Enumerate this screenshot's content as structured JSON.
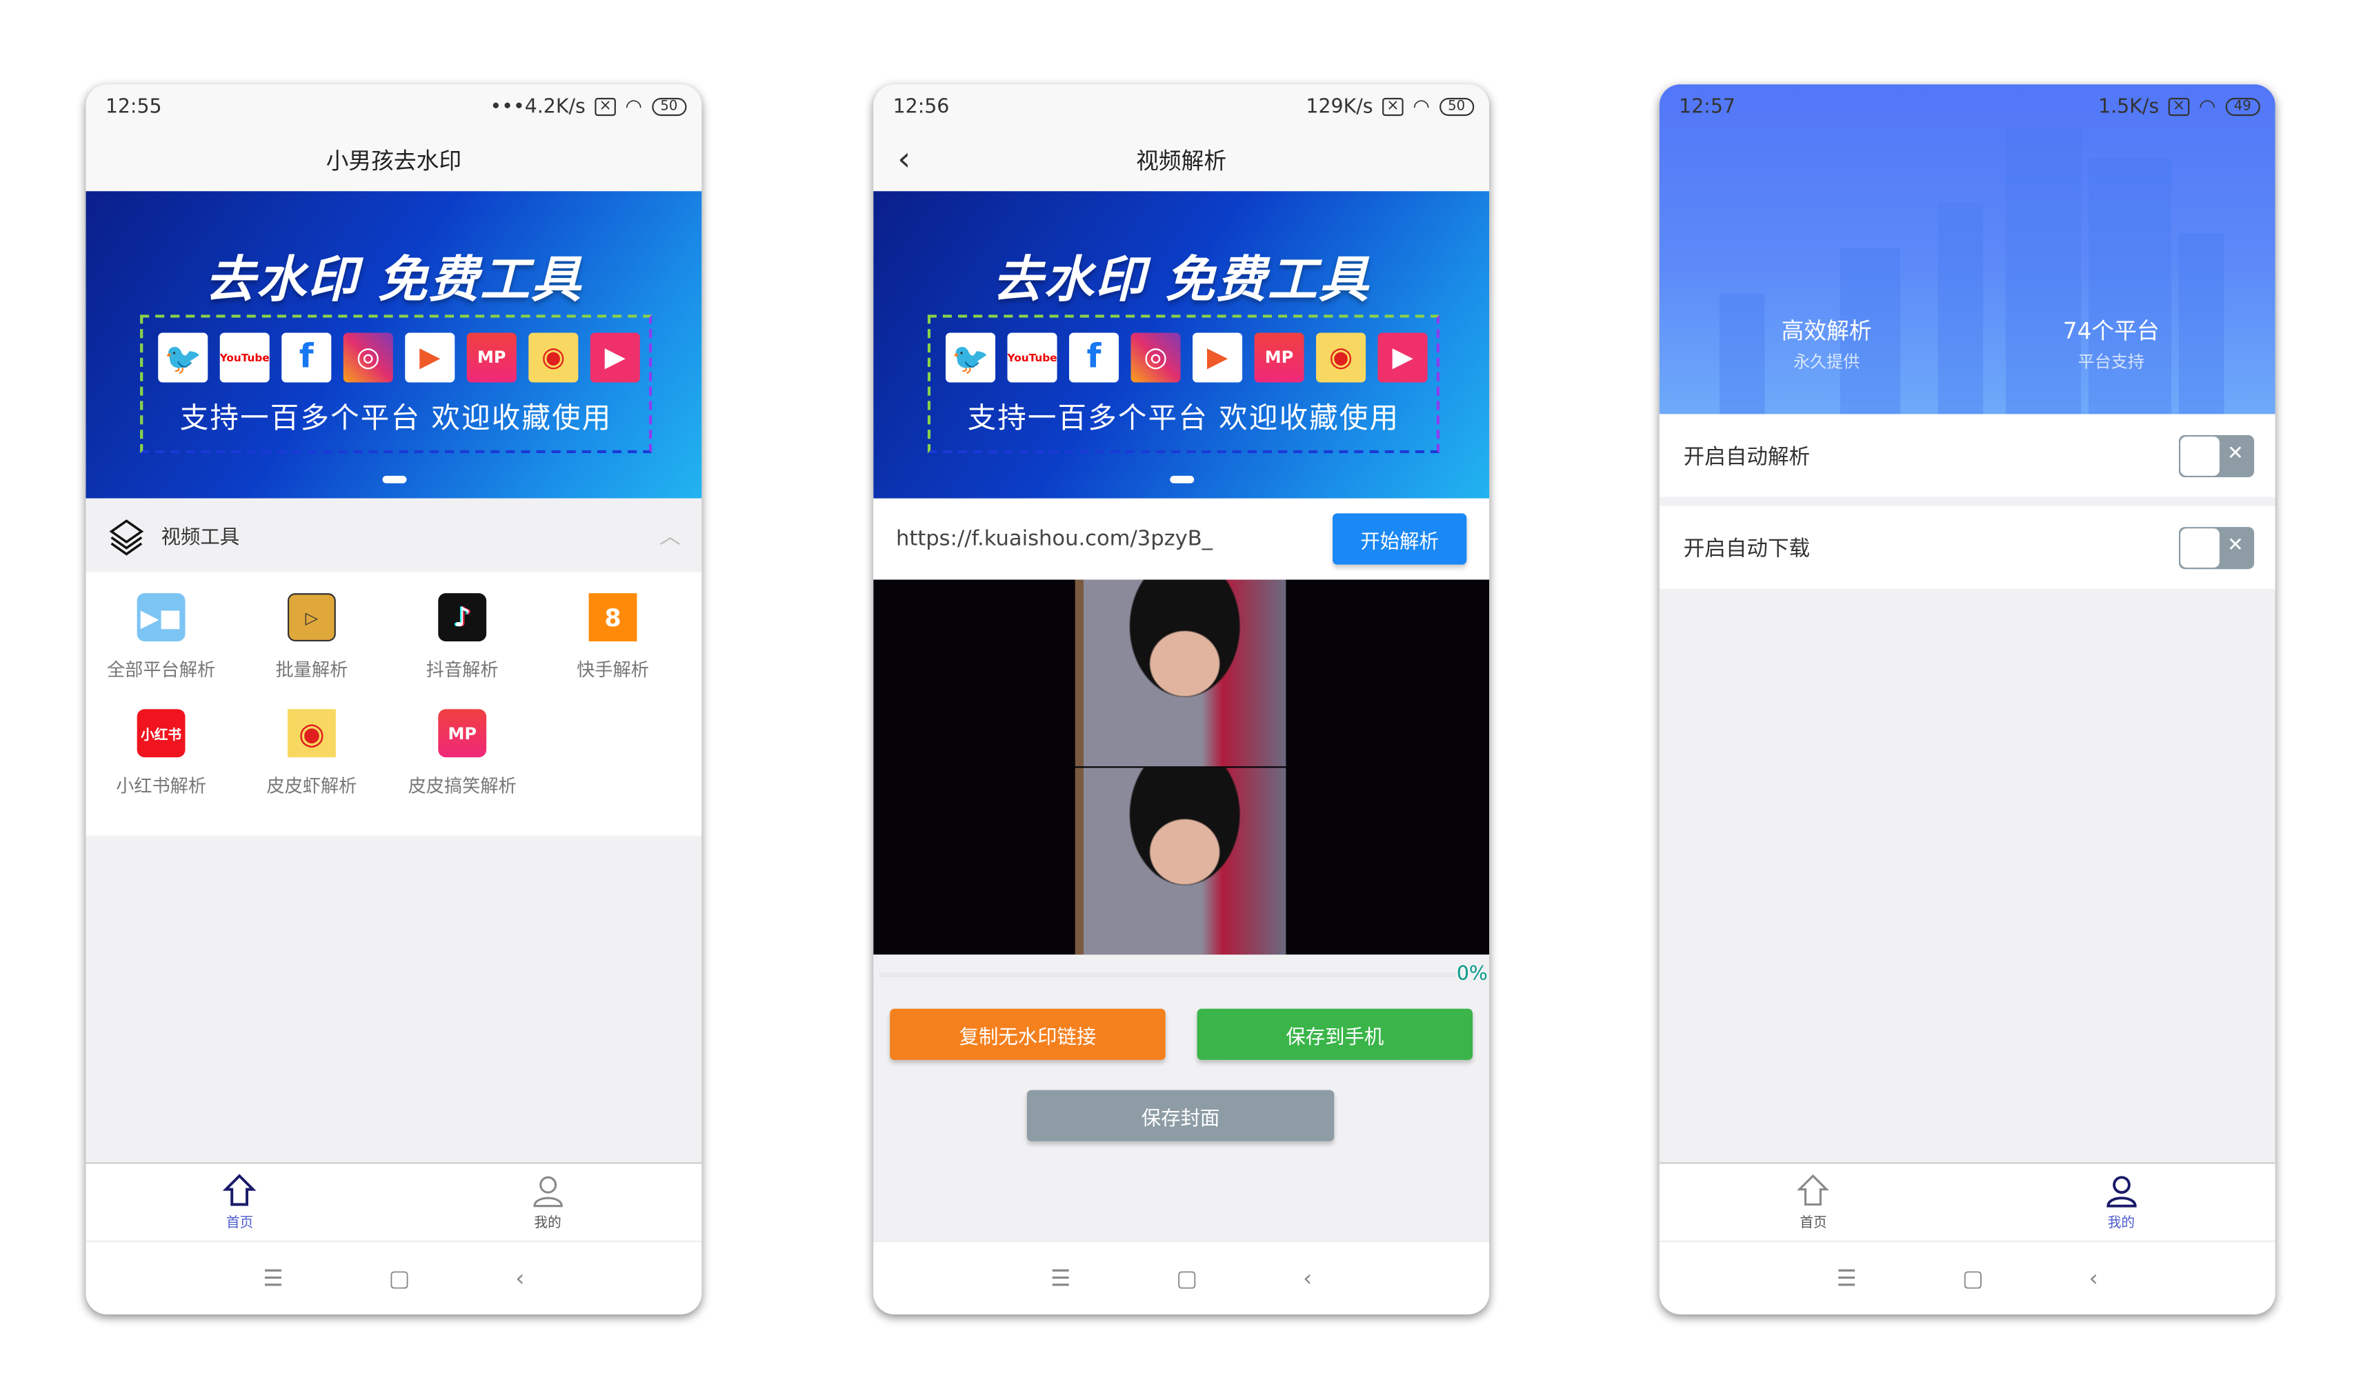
{
  "banner": {
    "title": "去水印 免费工具",
    "subtitle": "支持一百多个平台  欢迎收藏使用",
    "icons": [
      "twitter-icon",
      "youtube-icon",
      "facebook-icon",
      "instagram-icon",
      "play-icon",
      "mp-icon",
      "weibo-icon",
      "quanmin-icon"
    ],
    "icon_text": {
      "youtube": "YouTube",
      "facebook": "f",
      "mp": "MP"
    }
  },
  "screen1": {
    "status": {
      "time": "12:55",
      "speed": "•••4.2K/s",
      "battery": "50"
    },
    "title": "小男孩去水印",
    "section_title": "视频工具",
    "tools": [
      {
        "label": "全部平台解析",
        "color": "#7cc4f4"
      },
      {
        "label": "批量解析",
        "color": "#e0a83a"
      },
      {
        "label": "抖音解析",
        "color": "#111111"
      },
      {
        "label": "快手解析",
        "color": "#ff8a0a"
      },
      {
        "label": "小红书解析",
        "color": "#f0141e",
        "icon_text": "小红书"
      },
      {
        "label": "皮皮虾解析",
        "color": "#f8d860"
      },
      {
        "label": "皮皮搞笑解析",
        "color": "#f0287a",
        "icon_text": "MP"
      }
    ],
    "tabs": [
      {
        "label": "首页"
      },
      {
        "label": "我的"
      }
    ]
  },
  "screen2": {
    "status": {
      "time": "12:56",
      "speed": "129K/s",
      "battery": "50"
    },
    "title": "视频解析",
    "url_value": "https://f.kuaishou.com/3pzyB_",
    "start_button": "开始解析",
    "progress_percent": 0,
    "progress_label": "0%",
    "copy_button": "复制无水印链接",
    "save_button": "保存到手机",
    "cover_button": "保存封面",
    "colors": {
      "accent": "#1a88f5",
      "orange": "#f5801e",
      "green": "#3bb54a",
      "gray": "#8d9ca5"
    }
  },
  "screen3": {
    "status": {
      "time": "12:57",
      "speed": "1.5K/s",
      "battery": "49"
    },
    "stats": [
      {
        "big": "高效解析",
        "small": "永久提供"
      },
      {
        "big": "74个平台",
        "small": "平台支持"
      }
    ],
    "settings": [
      {
        "label": "开启自动解析",
        "on": false
      },
      {
        "label": "开启自动下载",
        "on": false
      }
    ],
    "tabs": [
      {
        "label": "首页"
      },
      {
        "label": "我的"
      }
    ]
  },
  "navbar": {
    "menu": "☰",
    "home": "▢",
    "back": "‹"
  }
}
